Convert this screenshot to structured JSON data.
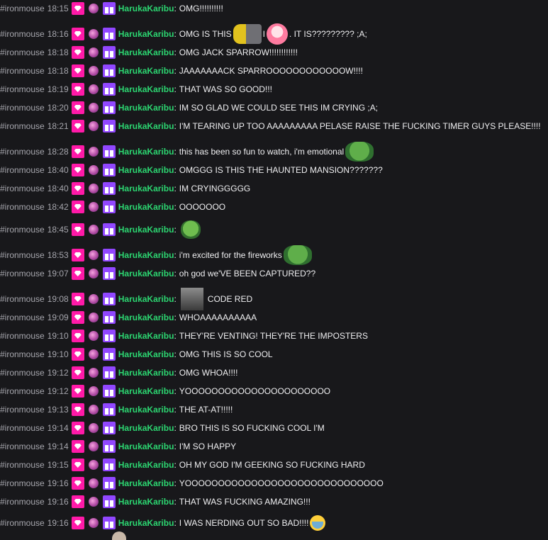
{
  "channel": "#ironmouse",
  "username": "HarukaKaribu",
  "messages": [
    {
      "time": "18:15",
      "text": "OMG!!!!!!!!!!"
    },
    {
      "time": "18:16",
      "text": "OMG IS THIS",
      "mid": "I",
      "tail": ". IT IS????????? ;A;",
      "emotes": [
        "emote-computer",
        "emote-anime-girl"
      ]
    },
    {
      "time": "18:18",
      "text": "OMG JACK SPARROW!!!!!!!!!!!!"
    },
    {
      "time": "18:18",
      "text": "JAAAAAAACK SPARROOOOOOOOOOOOW!!!!"
    },
    {
      "time": "18:19",
      "text": "THAT WAS SO GOOD!!!"
    },
    {
      "time": "18:20",
      "text": "IM SO GLAD WE COULD SEE THIS IM CRYING ;A;"
    },
    {
      "time": "18:21",
      "text": "I'M TEARING UP TOO AAAAAAAAA PELASE RAISE THE FUCKING TIMER GUYS PLEASE!!!!"
    },
    {
      "time": "18:28",
      "text": "this has been so fun to watch, i'm emotional",
      "emotes": [
        "emote-pepe"
      ]
    },
    {
      "time": "18:40",
      "text": "OMGGG IS THIS THE HAUNTED MANSION???????"
    },
    {
      "time": "18:40",
      "text": "IM CRYINGGGGG"
    },
    {
      "time": "18:42",
      "text": "OOOOOOO"
    },
    {
      "time": "18:45",
      "text": "",
      "emotes": [
        "emote-pepe-small"
      ]
    },
    {
      "time": "18:53",
      "text": "i'm excited for the fireworks",
      "emotes": [
        "emote-pepe"
      ]
    },
    {
      "time": "19:07",
      "text": "oh god we'VE BEEN CAPTURED??"
    },
    {
      "time": "19:08",
      "text": "CODE RED",
      "emotes_before": [
        "emote-face"
      ]
    },
    {
      "time": "19:09",
      "text": "WHOAAAAAAAAAA"
    },
    {
      "time": "19:10",
      "text": "THEY'RE VENTING! THEY'RE THE IMPOSTERS"
    },
    {
      "time": "19:10",
      "text": "OMG THIS IS SO COOL"
    },
    {
      "time": "19:12",
      "text": "OMG WHOA!!!!"
    },
    {
      "time": "19:12",
      "text": "YOOOOOOOOOOOOOOOOOOOOOO"
    },
    {
      "time": "19:13",
      "text": "THE AT-AT!!!!!"
    },
    {
      "time": "19:14",
      "text": "BRO THIS IS SO FUCKING COOL I'M"
    },
    {
      "time": "19:14",
      "text": "I'M SO HAPPY"
    },
    {
      "time": "19:15",
      "text": "OH MY GOD I'M GEEKING SO FUCKING HARD"
    },
    {
      "time": "19:16",
      "text": "YOOOOOOOOOOOOOOOOOOOOOOOOOOOOOO"
    },
    {
      "time": "19:16",
      "text": "THAT WAS FUCKING AMAZING!!!"
    },
    {
      "time": "19:16",
      "text": "I WAS NERDING OUT SO BAD!!!!",
      "emotes": [
        "emote-crying-face"
      ]
    }
  ],
  "colors": {
    "background": "#18181b",
    "username": "#2cd671",
    "meta": "#a6a6ad",
    "text": "#efeff1",
    "sub_badge": "#ff1aa8",
    "gift_badge": "#9147ff"
  },
  "badges": [
    "subscriber-badge-icon",
    "character-badge-icon",
    "gift-badge-icon"
  ]
}
